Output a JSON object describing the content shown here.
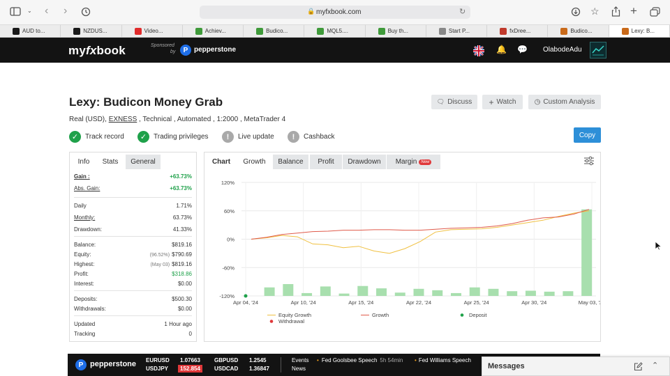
{
  "browser": {
    "url": "myfxbook.com",
    "tabs": [
      {
        "label": "AUD to...",
        "color": "#1a1a1a"
      },
      {
        "label": "NZDUS...",
        "color": "#1a1a1a"
      },
      {
        "label": "Video...",
        "color": "#e02b2b"
      },
      {
        "label": "Achiev...",
        "color": "#3f9a3a"
      },
      {
        "label": "Budico...",
        "color": "#3f9a3a"
      },
      {
        "label": "MQL5....",
        "color": "#3f9a3a"
      },
      {
        "label": "Buy th...",
        "color": "#3f9a3a"
      },
      {
        "label": "Start P...",
        "color": "#888888"
      },
      {
        "label": "fxDree...",
        "color": "#c0392b"
      },
      {
        "label": "Budico...",
        "color": "#c96a1a"
      },
      {
        "label": "Lexy: B...",
        "color": "#c96a1a"
      }
    ]
  },
  "nav": {
    "logo_my": "my",
    "logo_fx": "fx",
    "logo_book": "book",
    "sponsored": "Sponsored",
    "by": "by",
    "sponsor": "pepperstone",
    "username": "OlabodeAdu"
  },
  "header": {
    "title": "Lexy: Budicon Money Grab",
    "subtitle_pre": "Real (USD), ",
    "broker": "EXNESS",
    "subtitle_post": " , Technical , Automated , 1:2000 , MetaTrader 4",
    "discuss": "Discuss",
    "watch": "Watch",
    "custom_analysis": "Custom Analysis",
    "copy": "Copy",
    "statuses": [
      {
        "label": "Track record",
        "ok": true
      },
      {
        "label": "Trading privileges",
        "ok": true
      },
      {
        "label": "Live update",
        "ok": false
      },
      {
        "label": "Cashback",
        "ok": false
      }
    ]
  },
  "info": {
    "tabs": [
      "Info",
      "Stats",
      "General"
    ],
    "rows": [
      {
        "label": "Gain :",
        "value": "+63.73%"
      },
      {
        "label": "Abs. Gain:",
        "value": "+63.73%"
      },
      {
        "label": "Daily",
        "value": "1.71%"
      },
      {
        "label": "Monthly:",
        "value": "63.73%"
      },
      {
        "label": "Drawdown:",
        "value": "41.33%"
      },
      {
        "label": "Balance:",
        "value": "$819.16"
      },
      {
        "label": "Equity:",
        "sub": "(96.52%)",
        "value": "$790.69"
      },
      {
        "label": "Highest:",
        "sub": "(May 03)",
        "value": "$819.16"
      },
      {
        "label": "Profit:",
        "value": "$318.86"
      },
      {
        "label": "Interest:",
        "value": "$0.00"
      },
      {
        "label": "Deposits:",
        "value": "$500.30"
      },
      {
        "label": "Withdrawals:",
        "value": "$0.00"
      },
      {
        "label": "Updated",
        "value": "1 Hour ago"
      },
      {
        "label": "Tracking",
        "value": "0"
      }
    ]
  },
  "chart_panel": {
    "tabs": [
      "Chart",
      "Growth",
      "Balance",
      "Profit",
      "Drawdown",
      "Margin"
    ],
    "new_badge": "New"
  },
  "chart_data": {
    "type": "line",
    "y_ticks": [
      "120%",
      "60%",
      "0%",
      "-60%",
      "-120%"
    ],
    "x_ticks": [
      "Apr 04, '24",
      "Apr 10, '24",
      "Apr 15, '24",
      "Apr 22, '24",
      "Apr 25, '24",
      "Apr 30, '24",
      "May 03, '24"
    ],
    "ylim": [
      -120,
      120
    ],
    "legend": [
      "Equity Growth",
      "Growth",
      "Deposit",
      "Withdrawal"
    ],
    "colors": {
      "equity": "#f0c040",
      "growth": "#e05a4a",
      "bars": "#a8dfae",
      "deposit": "#1fa14a",
      "withdrawal": "#e0383a"
    },
    "series": [
      {
        "name": "Equity Growth",
        "values": [
          0,
          3,
          8,
          5,
          -10,
          -12,
          -18,
          -15,
          -25,
          -30,
          -20,
          -5,
          15,
          20,
          21,
          22,
          25,
          30,
          35,
          40,
          48,
          55,
          60
        ]
      },
      {
        "name": "Growth",
        "values": [
          0,
          4,
          10,
          13,
          16,
          17,
          19,
          19,
          20,
          20,
          19,
          19,
          21,
          23,
          24,
          25,
          28,
          33,
          40,
          45,
          47,
          53,
          63
        ]
      }
    ],
    "bars": [
      0,
      18,
      25,
      6,
      20,
      5,
      21,
      16,
      7,
      15,
      12,
      6,
      18,
      15,
      10,
      11,
      9,
      10,
      100
    ],
    "deposit_index": 0
  },
  "ticker": {
    "brand": "pepperstone",
    "pairs": [
      {
        "sym": "EURUSD",
        "price": "1.07663"
      },
      {
        "sym": "GBPUSD",
        "price": "1.2545"
      },
      {
        "sym": "USDJPY",
        "price": "152.854"
      },
      {
        "sym": "USDCAD",
        "price": "1.36847"
      }
    ],
    "events_label": "Events",
    "news_label": "News",
    "event1": "Fed Goolsbee Speech",
    "event1_time": "5h 54min",
    "event2": "Fed Williams Speech"
  },
  "messages": {
    "title": "Messages"
  }
}
